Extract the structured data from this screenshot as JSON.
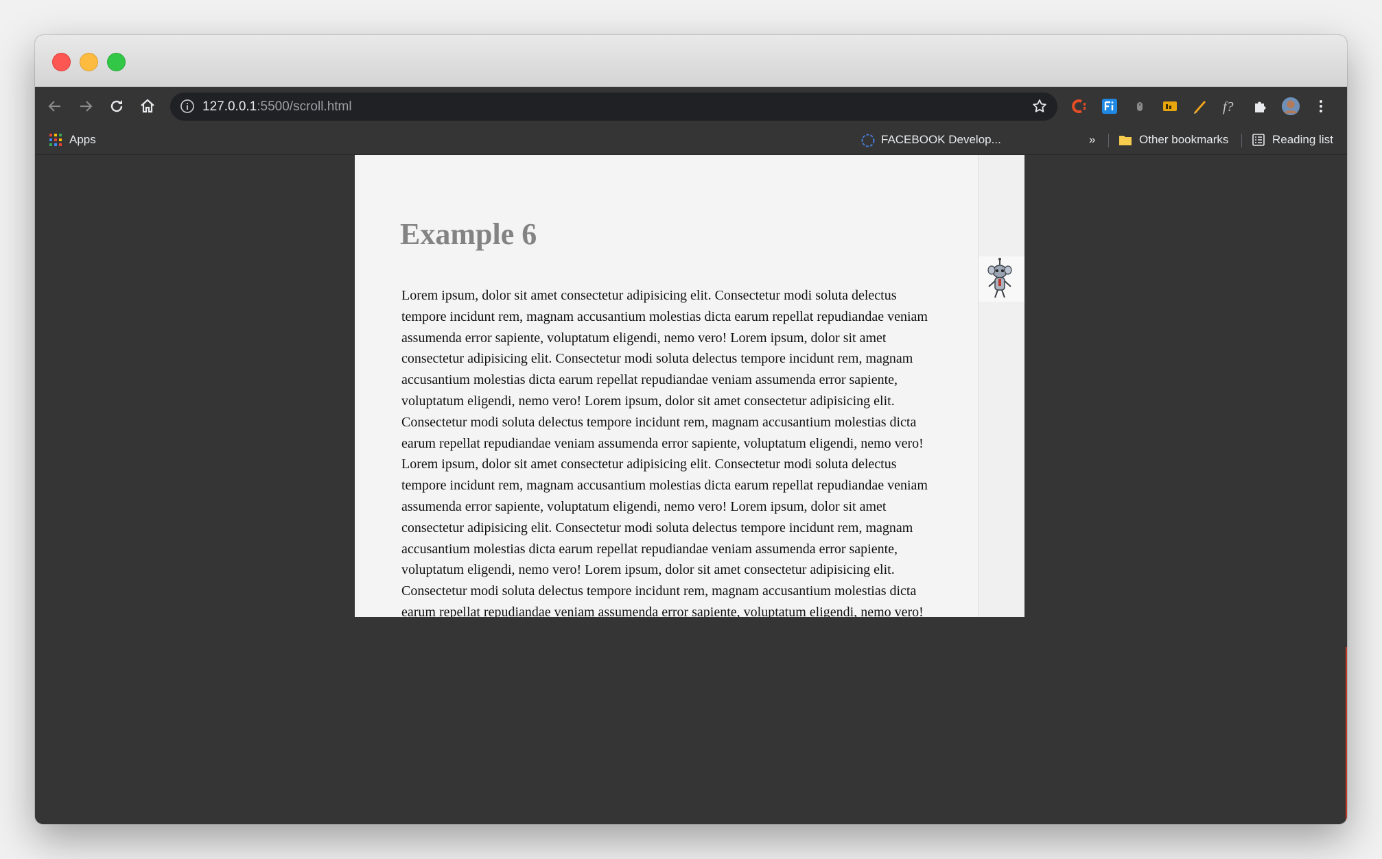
{
  "browser": {
    "url_host": "127.0.0.1",
    "url_path": ":5500/scroll.html",
    "nav_icons": [
      "back-arrow-icon",
      "forward-arrow-icon",
      "reload-icon",
      "home-icon"
    ],
    "extensions": [
      "codelf-extension-icon",
      "fi-extension-icon",
      "mouse-extension-icon",
      "rss-extension-icon",
      "pencil-extension-icon",
      "formula-extension-icon",
      "puzzle-extensions-icon",
      "profile-avatar",
      "kebab-menu-icon"
    ]
  },
  "bookmarks": {
    "apps_label": "Apps",
    "facebook_label": "FACEBOOK Develop...",
    "overflow_label": "»",
    "other_label": "Other bookmarks",
    "reading_label": "Reading list"
  },
  "page": {
    "heading": "Example 6",
    "paragraph": "Lorem ipsum, dolor sit amet consectetur adipisicing elit. Consectetur modi soluta delectus tempore incidunt rem, magnam accusantium molestias dicta earum repellat repudiandae veniam assumenda error sapiente, voluptatum eligendi, nemo vero! Lorem ipsum, dolor sit amet consectetur adipisicing elit. Consectetur modi soluta delectus tempore incidunt rem, magnam accusantium molestias dicta earum repellat repudiandae veniam assumenda error sapiente, voluptatum eligendi, nemo vero! Lorem ipsum, dolor sit amet consectetur adipisicing elit. Consectetur modi soluta delectus tempore incidunt rem, magnam accusantium molestias dicta earum repellat repudiandae veniam assumenda error sapiente, voluptatum eligendi, nemo vero! Lorem ipsum, dolor sit amet consectetur adipisicing elit. Consectetur modi soluta delectus tempore incidunt rem, magnam accusantium molestias dicta earum repellat repudiandae veniam assumenda error sapiente, voluptatum eligendi, nemo vero! Lorem ipsum, dolor sit amet consectetur adipisicing elit. Consectetur modi soluta delectus tempore incidunt rem, magnam accusantium molestias dicta earum repellat repudiandae veniam assumenda error sapiente, voluptatum eligendi, nemo vero! Lorem ipsum, dolor sit amet consectetur adipisicing elit. Consectetur modi soluta delectus tempore incidunt rem, magnam accusantium molestias dicta earum repellat repudiandae veniam assumenda error sapiente, voluptatum eligendi, nemo vero!"
  },
  "colors": {
    "chrome_dark": "#353535",
    "omnibox": "#202124",
    "page_bg": "#f4f4f4",
    "heading": "#838383"
  }
}
